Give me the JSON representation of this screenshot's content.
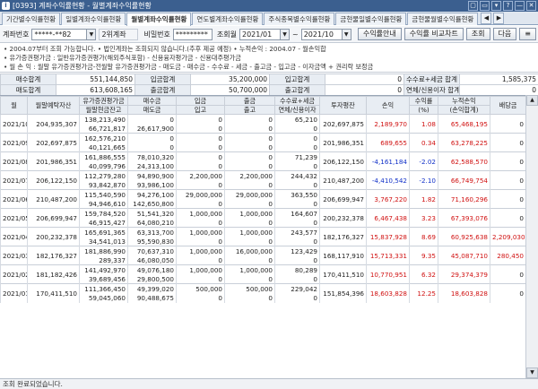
{
  "window": {
    "title": "[0393] 계좌수익률현황 - 월별계좌수익률현황",
    "icon_letter": "i",
    "buttons": [
      "▢",
      "▭",
      "▾",
      "?",
      "—",
      "✕"
    ]
  },
  "tabs": [
    {
      "label": "기간별수익률현황",
      "active": false
    },
    {
      "label": "일별계좌수익률현황",
      "active": false
    },
    {
      "label": "월별계좌수익률현황",
      "active": true
    },
    {
      "label": "연도별계좌수익률현황",
      "active": false
    },
    {
      "label": "주식종목별수익률현황",
      "active": false
    },
    {
      "label": "금현물일별수익률현황",
      "active": false
    },
    {
      "label": "금현물월별수익률현황",
      "active": false
    }
  ],
  "toolbar": {
    "account_label": "계좌번호",
    "account_value": "*****-**82",
    "account_type": "2위계좌",
    "password_label": "비밀번호",
    "password_value": "*********",
    "period_label": "조회월",
    "from_value": "2021/01",
    "tilde": "~",
    "to_value": "2021/10",
    "btn_guide": "수익률안내",
    "btn_compare": "수익률 비교차트",
    "btn_search": "조회",
    "btn_next": "다음",
    "btn_menu": "≡"
  },
  "notices": [
    "• 2004.07부터 조회 가능합니다.      • 법인계좌는 조회되지 않습니다.(추후 제공 예정)      • 누적손익 : 2004.07 - 월손익합",
    "• 유가증권평가금 : 일반유가증권평가(해외주식포함) - 신용융자평가금 - 신용대주평가금",
    "• 월 손 익 : 월말 유가증권평가금-전월말 유가증권평가금 - 매도금 - 매수금 - 수수료 - 세금 - 출고금 - 입고금 - 이자금액 + 권리락 보정금"
  ],
  "summary": {
    "buy_label": "매수합계",
    "buy_value": "551,144,850",
    "in_label": "입금합계",
    "in_value": "35,200,000",
    "incoming_label": "입고합계",
    "incoming_value": "0",
    "fee_label": "수수료+세금 합계",
    "fee_value": "1,585,375",
    "sell_label": "매도합계",
    "sell_value": "613,608,165",
    "out_label": "출금합계",
    "out_value": "50,700,000",
    "outgoing_label": "출고합계",
    "outgoing_value": "0",
    "interest_label": "연체/신용이자 합계",
    "interest_value": "0"
  },
  "grid": {
    "headers_top": [
      "월",
      "월말예탁자산",
      "유가증권평가금",
      "매수금",
      "입금",
      "출금",
      "수수료+세금",
      "투자평잔",
      "손익",
      "수익률",
      "누적손익",
      "배당금"
    ],
    "headers_bottom": [
      "월말현금잔고",
      "매도금",
      "입고",
      "출고",
      "연체/신용이자",
      "(%)",
      "(손익합계)"
    ],
    "rows": [
      {
        "month": "2021/10",
        "asset": "204,935,307",
        "eval": "138,213,490",
        "cash": "66,721,817",
        "buy": "0",
        "sell": "26,617,900",
        "in": "0",
        "incoming": "0",
        "out": "0",
        "outgoing": "0",
        "fee": "65,210",
        "interest": "0",
        "avg": "202,697,875",
        "pnl": "2,189,970",
        "pnl_sign": "pos",
        "rate": "1.08",
        "rate_sign": "pos",
        "cum": "65,468,195",
        "cum_sign": "pos",
        "div": "0",
        "div_sign": "zero"
      },
      {
        "month": "2021/09",
        "asset": "202,697,875",
        "eval": "162,576,210",
        "cash": "40,121,665",
        "buy": "0",
        "sell": "0",
        "in": "0",
        "incoming": "0",
        "out": "0",
        "outgoing": "0",
        "fee": "0",
        "interest": "0",
        "avg": "201,986,351",
        "pnl": "689,655",
        "pnl_sign": "pos",
        "rate": "0.34",
        "rate_sign": "pos",
        "cum": "63,278,225",
        "cum_sign": "pos",
        "div": "0",
        "div_sign": "zero"
      },
      {
        "month": "2021/08",
        "asset": "201,986,351",
        "eval": "161,886,555",
        "cash": "40,099,796",
        "buy": "78,010,320",
        "sell": "24,313,100",
        "in": "0",
        "incoming": "0",
        "out": "0",
        "outgoing": "0",
        "fee": "71,239",
        "interest": "0",
        "avg": "206,122,150",
        "pnl": "-4,161,184",
        "pnl_sign": "neg",
        "rate": "-2.02",
        "rate_sign": "neg",
        "cum": "62,588,570",
        "cum_sign": "pos",
        "div": "0",
        "div_sign": "zero"
      },
      {
        "month": "2021/07",
        "asset": "206,122,150",
        "eval": "112,279,280",
        "cash": "93,842,870",
        "buy": "94,890,900",
        "sell": "93,986,100",
        "in": "2,200,000",
        "incoming": "0",
        "out": "2,200,000",
        "outgoing": "0",
        "fee": "244,432",
        "interest": "0",
        "avg": "210,487,200",
        "pnl": "-4,410,542",
        "pnl_sign": "neg",
        "rate": "-2.10",
        "rate_sign": "neg",
        "cum": "66,749,754",
        "cum_sign": "pos",
        "div": "0",
        "div_sign": "zero"
      },
      {
        "month": "2021/06",
        "asset": "210,487,200",
        "eval": "115,540,590",
        "cash": "94,946,610",
        "buy": "94,276,100",
        "sell": "142,650,800",
        "in": "29,000,000",
        "incoming": "0",
        "out": "29,000,000",
        "outgoing": "0",
        "fee": "363,550",
        "interest": "0",
        "avg": "206,699,947",
        "pnl": "3,767,220",
        "pnl_sign": "pos",
        "rate": "1.82",
        "rate_sign": "pos",
        "cum": "71,160,296",
        "cum_sign": "pos",
        "div": "0",
        "div_sign": "zero"
      },
      {
        "month": "2021/05",
        "asset": "206,699,947",
        "eval": "159,784,520",
        "cash": "46,915,427",
        "buy": "51,541,320",
        "sell": "64,080,210",
        "in": "1,000,000",
        "incoming": "0",
        "out": "1,000,000",
        "outgoing": "0",
        "fee": "164,607",
        "interest": "0",
        "avg": "200,232,378",
        "pnl": "6,467,438",
        "pnl_sign": "pos",
        "rate": "3.23",
        "rate_sign": "pos",
        "cum": "67,393,076",
        "cum_sign": "pos",
        "div": "0",
        "div_sign": "zero"
      },
      {
        "month": "2021/04",
        "asset": "200,232,378",
        "eval": "165,691,365",
        "cash": "34,541,013",
        "buy": "63,313,700",
        "sell": "95,590,830",
        "in": "1,000,000",
        "incoming": "0",
        "out": "1,000,000",
        "outgoing": "0",
        "fee": "243,577",
        "interest": "0",
        "avg": "182,176,327",
        "pnl": "15,837,928",
        "pnl_sign": "pos",
        "rate": "8.69",
        "rate_sign": "pos",
        "cum": "60,925,638",
        "cum_sign": "pos",
        "div": "2,209,030",
        "div_sign": "pos"
      },
      {
        "month": "2021/03",
        "asset": "182,176,327",
        "eval": "181,886,990",
        "cash": "289,337",
        "buy": "70,637,310",
        "sell": "46,080,050",
        "in": "1,000,000",
        "incoming": "0",
        "out": "16,000,000",
        "outgoing": "0",
        "fee": "123,429",
        "interest": "0",
        "avg": "168,117,910",
        "pnl": "15,713,331",
        "pnl_sign": "pos",
        "rate": "9.35",
        "rate_sign": "pos",
        "cum": "45,087,710",
        "cum_sign": "pos",
        "div": "280,450",
        "div_sign": "pos"
      },
      {
        "month": "2021/02",
        "asset": "181,182,426",
        "eval": "141,492,970",
        "cash": "39,689,456",
        "buy": "49,076,180",
        "sell": "29,800,500",
        "in": "1,000,000",
        "incoming": "0",
        "out": "1,000,000",
        "outgoing": "0",
        "fee": "80,289",
        "interest": "0",
        "avg": "170,411,510",
        "pnl": "10,770,951",
        "pnl_sign": "pos",
        "rate": "6.32",
        "rate_sign": "pos",
        "cum": "29,374,379",
        "cum_sign": "pos",
        "div": "0",
        "div_sign": "zero"
      },
      {
        "month": "2021/01",
        "asset": "170,411,510",
        "eval": "111,366,450",
        "cash": "59,045,060",
        "buy": "49,399,020",
        "sell": "90,488,675",
        "in": "500,000",
        "incoming": "0",
        "out": "500,000",
        "outgoing": "0",
        "fee": "229,042",
        "interest": "0",
        "avg": "151,854,396",
        "pnl": "18,603,828",
        "pnl_sign": "pos",
        "rate": "12.25",
        "rate_sign": "pos",
        "cum": "18,603,828",
        "cum_sign": "pos",
        "div": "0",
        "div_sign": "zero"
      }
    ]
  },
  "status": {
    "message": "조회 완료되었습니다."
  },
  "colors": {
    "positive": "#d01010",
    "negative": "#1030c8",
    "header_bg": "#e8edf3",
    "titlebar": "#3b5f8f"
  },
  "icons": {
    "app": "app-icon",
    "dropdown": "chevron-down-icon",
    "scroll_up": "arrow-up-icon",
    "scroll_down": "arrow-down-icon"
  }
}
